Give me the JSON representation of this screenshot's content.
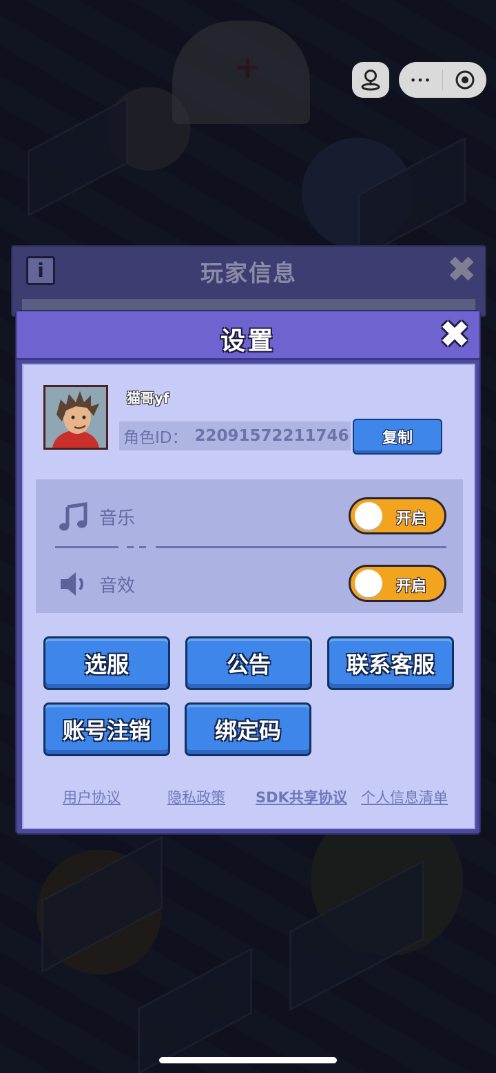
{
  "background_panel": {
    "title": "玩家信息",
    "close_glyph": "✖",
    "info_glyph": "i"
  },
  "mini_program_capsule": {
    "more_glyph": "•••",
    "game_icon": "joystick-icon",
    "close_icon": "target-icon"
  },
  "settings": {
    "title": "设置",
    "close_glyph": "✖",
    "profile": {
      "nickname": "猫哥yf",
      "id_label": "角色ID：",
      "id_value": "22091572211746",
      "copy_label": "复制"
    },
    "audio": {
      "music": {
        "label": "音乐",
        "toggle_text": "开启",
        "icon": "music-note-icon",
        "on": true
      },
      "sfx": {
        "label": "音效",
        "toggle_text": "开启",
        "icon": "speaker-icon",
        "on": true
      }
    },
    "buttons": {
      "select_server": "选服",
      "announcement": "公告",
      "contact_support": "联系客服",
      "delete_account": "账号注销",
      "bind_code": "绑定码"
    },
    "links": {
      "user_agreement": "用户协议",
      "privacy_policy": "隐私政策",
      "sdk_agreement": "SDK共享协议",
      "personal_info_list": "个人信息清单"
    }
  },
  "colors": {
    "dialog_header": "#6e63cf",
    "dialog_body": "#c6cbf7",
    "button_blue": "#3f86ea",
    "toggle_on": "#f2a41e"
  }
}
